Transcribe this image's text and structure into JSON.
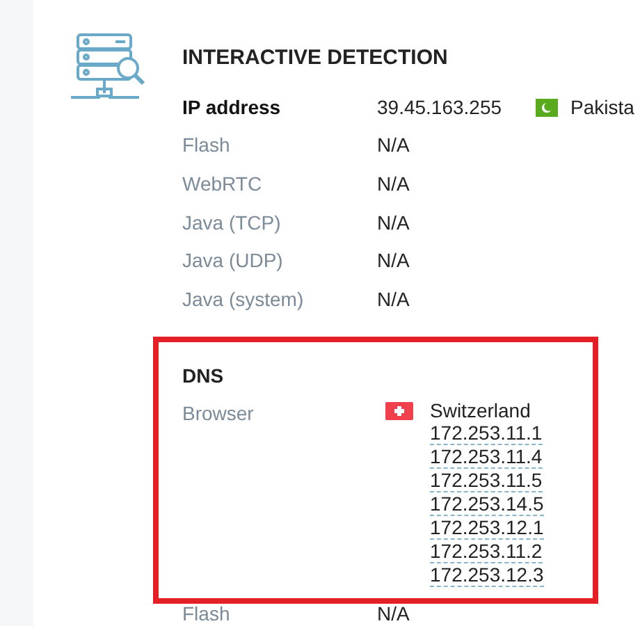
{
  "section": {
    "title": "INTERACTIVE DETECTION"
  },
  "ip": {
    "label": "IP address",
    "value": "39.45.163.255",
    "country": "Pakista"
  },
  "rows": [
    {
      "label": "Flash",
      "value": "N/A"
    },
    {
      "label": "WebRTC",
      "value": "N/A"
    },
    {
      "label": "Java (TCP)",
      "value": "N/A"
    },
    {
      "label": "Java (UDP)",
      "value": "N/A"
    },
    {
      "label": "Java (system)",
      "value": "N/A"
    }
  ],
  "dns": {
    "title": "DNS",
    "label": "Browser",
    "country": "Switzerland",
    "addresses": [
      "172.253.11.1",
      "172.253.11.4",
      "172.253.11.5",
      "172.253.14.5",
      "172.253.12.1",
      "172.253.11.2",
      "172.253.12.3"
    ]
  },
  "bottom_row": {
    "label": "Flash",
    "value": "N/A"
  }
}
